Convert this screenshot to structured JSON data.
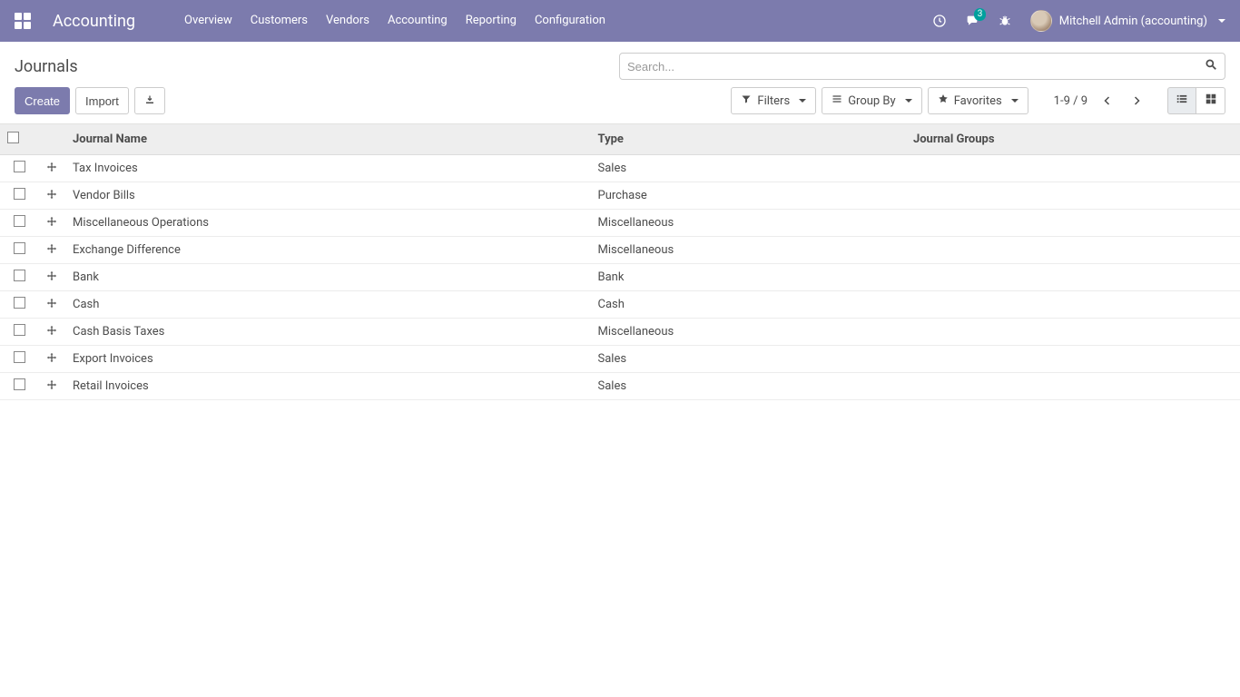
{
  "brand": "Accounting",
  "nav": [
    "Overview",
    "Customers",
    "Vendors",
    "Accounting",
    "Reporting",
    "Configuration"
  ],
  "messages_badge": "3",
  "user": {
    "name": "Mitchell Admin (accounting)"
  },
  "page_title": "Journals",
  "search": {
    "placeholder": "Search..."
  },
  "buttons": {
    "create": "Create",
    "import": "Import"
  },
  "search_controls": {
    "filters": "Filters",
    "group_by": "Group By",
    "favorites": "Favorites"
  },
  "pager": {
    "range": "1-9 / 9"
  },
  "columns": {
    "name": "Journal Name",
    "type": "Type",
    "groups": "Journal Groups"
  },
  "rows": [
    {
      "name": "Tax Invoices",
      "type": "Sales",
      "groups": ""
    },
    {
      "name": "Vendor Bills",
      "type": "Purchase",
      "groups": ""
    },
    {
      "name": "Miscellaneous Operations",
      "type": "Miscellaneous",
      "groups": ""
    },
    {
      "name": "Exchange Difference",
      "type": "Miscellaneous",
      "groups": ""
    },
    {
      "name": "Bank",
      "type": "Bank",
      "groups": ""
    },
    {
      "name": "Cash",
      "type": "Cash",
      "groups": ""
    },
    {
      "name": "Cash Basis Taxes",
      "type": "Miscellaneous",
      "groups": ""
    },
    {
      "name": "Export Invoices",
      "type": "Sales",
      "groups": ""
    },
    {
      "name": "Retail Invoices",
      "type": "Sales",
      "groups": ""
    }
  ]
}
